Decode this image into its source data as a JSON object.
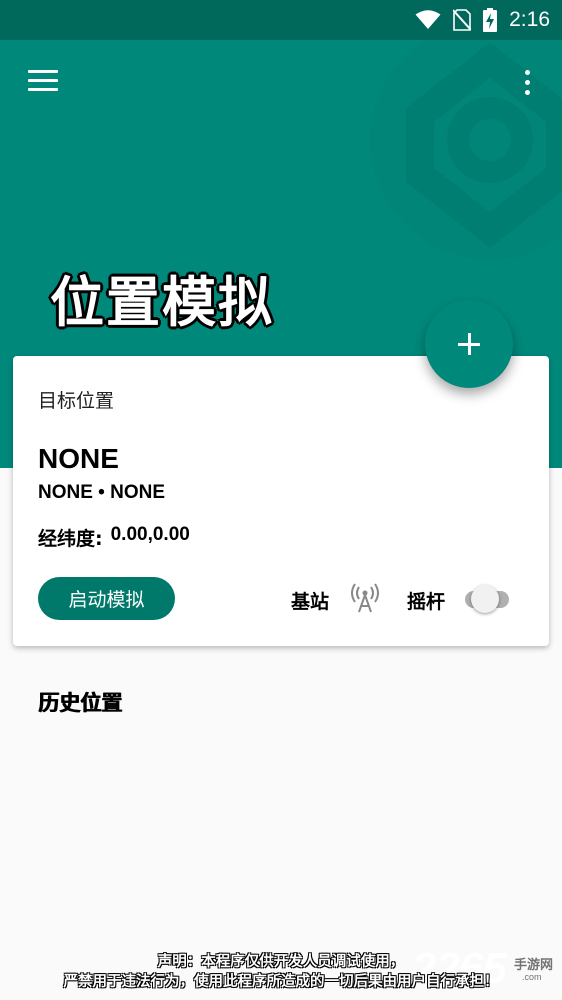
{
  "status_bar": {
    "time": "2:16",
    "icons": [
      "wifi-icon",
      "no-sim-icon",
      "battery-charging-icon"
    ]
  },
  "colors": {
    "primary": "#00897b",
    "primary_dark": "#00695c",
    "button": "#00796b",
    "background": "#fafafa"
  },
  "header": {
    "title": "位置模拟",
    "menu_icon": "hamburger-menu-icon",
    "more_icon": "more-vert-icon",
    "fab_icon": "plus-icon"
  },
  "card": {
    "label": "目标位置",
    "location_name": "NONE",
    "location_sub": "NONE • NONE",
    "coords_label": "经纬度:",
    "coords_value": "0.00,0.00",
    "start_button": "启动模拟",
    "base_station_label": "基站",
    "base_station_icon": "antenna-icon",
    "joystick_label": "摇杆",
    "joystick_enabled": false
  },
  "history": {
    "title": "历史位置"
  },
  "footer": {
    "disclaimer_line1": "声明：本程序仅供开发人员调试使用，",
    "disclaimer_line2": "严禁用于违法行为，使用此程序所造成的一切后果由用户自行承担！",
    "watermark": "2265",
    "watermark_sub": "手游网",
    "watermark_sub2": ".com"
  }
}
